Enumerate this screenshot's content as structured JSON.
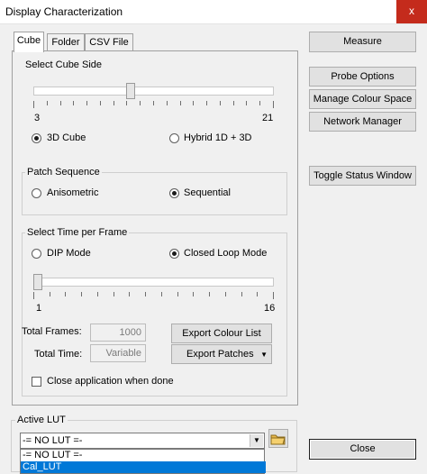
{
  "window": {
    "title": "Display Characterization",
    "close_glyph": "x"
  },
  "tabs": [
    {
      "label": "Cube",
      "active": true
    },
    {
      "label": "Folder",
      "active": false
    },
    {
      "label": "CSV File",
      "active": false
    }
  ],
  "cube_side": {
    "group_label": "Select Cube Side",
    "min_label": "3",
    "max_label": "21",
    "value_fraction": 0.4,
    "options": [
      {
        "label": "3D Cube",
        "selected": true
      },
      {
        "label": "Hybrid 1D + 3D",
        "selected": false
      }
    ]
  },
  "patch_sequence": {
    "group_label": "Patch Sequence",
    "options": [
      {
        "label": "Anisometric",
        "selected": false
      },
      {
        "label": "Sequential",
        "selected": true
      }
    ]
  },
  "time_per_frame": {
    "group_label": "Select Time per Frame",
    "options": [
      {
        "label": "DIP Mode",
        "selected": false
      },
      {
        "label": "Closed Loop Mode",
        "selected": true
      }
    ],
    "min_label": "1",
    "max_label": "16",
    "value_fraction": 0.0
  },
  "totals": {
    "frames_label": "Total Frames:",
    "frames_value": "1000",
    "time_label": "Total Time:",
    "time_value": "Variable"
  },
  "buttons": {
    "export_colour_list": "Export Colour List",
    "export_patches": "Export Patches",
    "measure": "Measure",
    "probe_options": "Probe Options",
    "manage_colour_space": "Manage Colour Space",
    "network_manager": "Network Manager",
    "toggle_status_window": "Toggle Status Window",
    "close": "Close"
  },
  "close_when_done": {
    "label": "Close application when done",
    "checked": false
  },
  "active_lut": {
    "group_label": "Active LUT",
    "selected": "-= NO LUT =-",
    "options": [
      "-= NO LUT =-",
      "Cal_LUT"
    ],
    "highlighted_index": 1,
    "highlight_color": "#0078d7"
  }
}
